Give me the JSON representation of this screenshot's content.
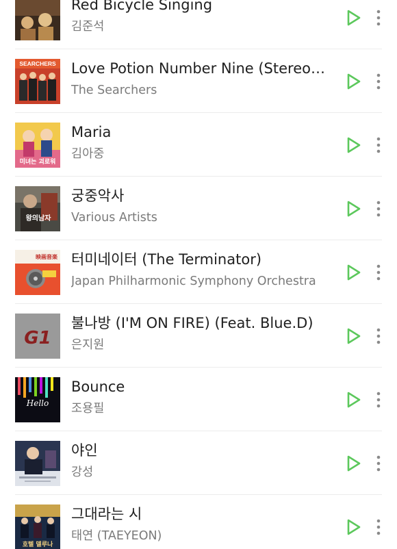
{
  "colors": {
    "accent": "#5cc85c",
    "title_text": "#202020",
    "artist_text": "#7a7a7a",
    "divider": "#ececec"
  },
  "songs": [
    {
      "title": "Red Bicycle Singing",
      "artist": "김준석",
      "cover_art_text": "",
      "icon": "play-icon"
    },
    {
      "title": "Love Potion Number Nine (Stereo…",
      "artist": "The Searchers",
      "cover_art_text": "SEARCHERS",
      "icon": "play-icon"
    },
    {
      "title": "Maria",
      "artist": "김아중",
      "cover_art_text": "미녀는 괴로워",
      "icon": "play-icon"
    },
    {
      "title": "궁중악사",
      "artist": "Various Artists",
      "cover_art_text": "왕의남자",
      "icon": "play-icon"
    },
    {
      "title": "터미네이터 (The  Terminator)",
      "artist": "Japan Philharmonic Symphony Orchestra",
      "cover_art_text": "映画音楽",
      "icon": "play-icon"
    },
    {
      "title": "불나방 (I'M ON FIRE) (Feat. Blue.D)",
      "artist": "은지원",
      "cover_art_text": "G1",
      "icon": "play-icon"
    },
    {
      "title": "Bounce",
      "artist": "조용필",
      "cover_art_text": "Hello",
      "icon": "play-icon"
    },
    {
      "title": "야인",
      "artist": "강성",
      "cover_art_text": "",
      "icon": "play-icon"
    },
    {
      "title": "그대라는 시",
      "artist": "태연 (TAEYEON)",
      "cover_art_text": "호텔 델루나",
      "icon": "play-icon"
    }
  ]
}
